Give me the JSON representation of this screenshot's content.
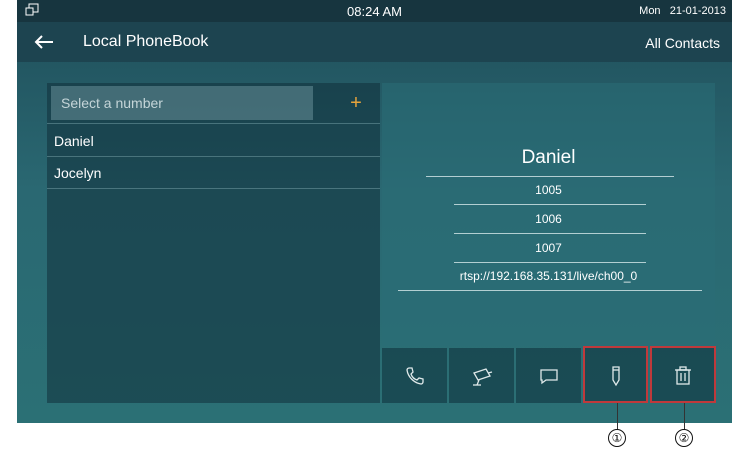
{
  "status_bar": {
    "time": "08:24 AM",
    "date": "Mon   21-01-2013",
    "left_icon": "copy-windows-icon"
  },
  "title_bar": {
    "back_icon": "arrow-left-icon",
    "title": "Local PhoneBook",
    "filter": "All Contacts"
  },
  "search": {
    "placeholder": "Select a number",
    "add_label": "+"
  },
  "contacts": [
    {
      "name": "Daniel"
    },
    {
      "name": "Jocelyn"
    }
  ],
  "detail": {
    "name": "Daniel",
    "numbers": [
      "1005",
      "1006",
      "1007"
    ],
    "url": "rtsp://192.168.35.131/live/ch00_0"
  },
  "actions": [
    {
      "icon": "phone-icon"
    },
    {
      "icon": "camera-icon"
    },
    {
      "icon": "message-icon"
    },
    {
      "icon": "edit-icon"
    },
    {
      "icon": "trash-icon"
    }
  ],
  "callouts": [
    "①",
    "②"
  ],
  "colors": {
    "accent": "#e6a43c",
    "highlight": "#c0393b",
    "screen_bg": "#2a6872"
  }
}
